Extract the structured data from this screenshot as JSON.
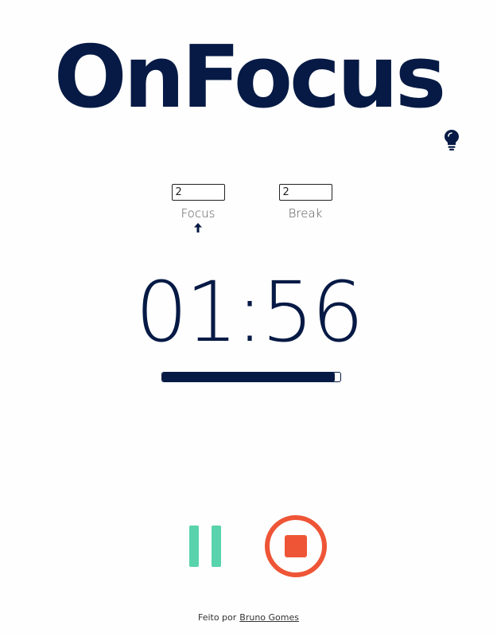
{
  "header": {
    "title": "OnFocus",
    "theme_toggle_icon": "lightbulb-icon"
  },
  "settings": {
    "focus": {
      "value": "2",
      "label": "Focus"
    },
    "break": {
      "value": "2",
      "label": "Break"
    },
    "active_mode_icon": "arrow-up-icon"
  },
  "timer": {
    "display": "01:56",
    "progress": 0.97
  },
  "controls": {
    "pause_icon": "pause-icon",
    "stop_icon": "stop-icon"
  },
  "footer": {
    "credit_text": "Feito por",
    "author": "Bruno Gomes"
  },
  "colors": {
    "primary": "#061a45",
    "pause": "#58d3ac",
    "stop": "#ee5536"
  }
}
